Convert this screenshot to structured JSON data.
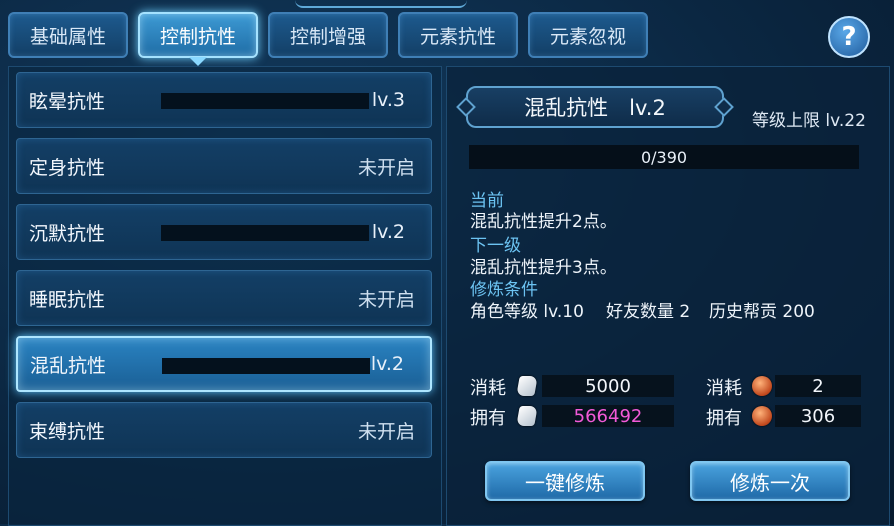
{
  "tabs": [
    {
      "label": "基础属性",
      "active": false
    },
    {
      "label": "控制抗性",
      "active": true
    },
    {
      "label": "控制增强",
      "active": false
    },
    {
      "label": "元素抗性",
      "active": false
    },
    {
      "label": "元素忽视",
      "active": false
    }
  ],
  "help_label": "?",
  "resistances": [
    {
      "name": "眩晕抗性",
      "level": "lv.3",
      "status": "",
      "selected": false
    },
    {
      "name": "定身抗性",
      "level": "",
      "status": "未开启",
      "selected": false
    },
    {
      "name": "沉默抗性",
      "level": "lv.2",
      "status": "",
      "selected": false
    },
    {
      "name": "睡眠抗性",
      "level": "",
      "status": "未开启",
      "selected": false
    },
    {
      "name": "混乱抗性",
      "level": "lv.2",
      "status": "",
      "selected": true
    },
    {
      "name": "束缚抗性",
      "level": "",
      "status": "未开启",
      "selected": false
    }
  ],
  "detail": {
    "title": "混乱抗性　lv.2",
    "max_level": "等级上限 lv.22",
    "exp_text": "0/390",
    "exp_fraction": 0,
    "current_label": "当前",
    "current_text": "混乱抗性提升2点。",
    "next_label": "下一级",
    "next_text": "混乱抗性提升3点。",
    "requirement_label": "修炼条件",
    "requirements": [
      "角色等级 lv.10",
      "好友数量 2",
      "历史帮贡 200"
    ]
  },
  "costs": {
    "consume_label": "消耗",
    "own_label": "拥有",
    "item1": {
      "icon": "scroll-icon",
      "consume": "5000",
      "own": "566492",
      "own_color": "#f25ad8"
    },
    "item2": {
      "icon": "coin-icon",
      "consume": "2",
      "own": "306"
    }
  },
  "buttons": {
    "one_click": "一键修炼",
    "once": "修炼一次"
  }
}
